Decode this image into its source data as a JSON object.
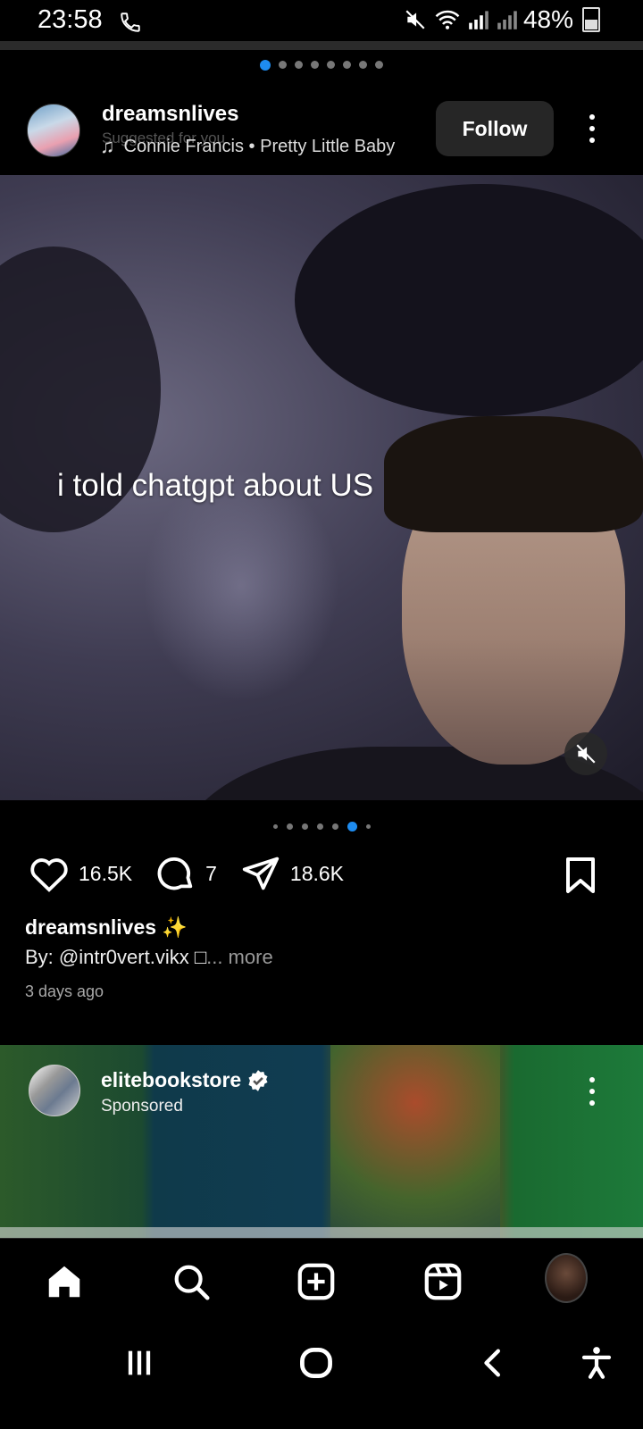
{
  "status_bar": {
    "time": "23:58",
    "battery": "48%",
    "icons": [
      "phone-call-icon",
      "mute-icon",
      "wifi-icon",
      "signal-icon",
      "signal-icon",
      "battery-icon"
    ]
  },
  "carousel_top": {
    "count": 8,
    "active_index": 0
  },
  "post": {
    "username": "dreamsnlives",
    "suggested": "Suggested for you",
    "music": "Connie Francis • Pretty Little Baby",
    "follow_label": "Follow",
    "overlay_text": "i told chatgpt about US",
    "carousel": {
      "count": 7,
      "active_index": 5
    },
    "likes": "16.5K",
    "comments": "7",
    "shares": "18.6K",
    "caption_user": "dreamsnlives ✨",
    "caption_text": "By: @intr0vert.vikx □",
    "caption_more": "... more",
    "time_ago": "3 days ago"
  },
  "sponsored_post": {
    "username": "elitebookstore",
    "label": "Sponsored",
    "verified": true
  },
  "bottom_nav": {
    "items": [
      "home-icon",
      "search-icon",
      "create-icon",
      "reels-icon",
      "profile-avatar"
    ],
    "active": "home-icon"
  },
  "system_nav": [
    "recents-icon",
    "home-circle-icon",
    "back-icon",
    "accessibility-icon"
  ],
  "colors": {
    "accent": "#1e8cf0",
    "background": "#000000",
    "button": "#262626"
  }
}
